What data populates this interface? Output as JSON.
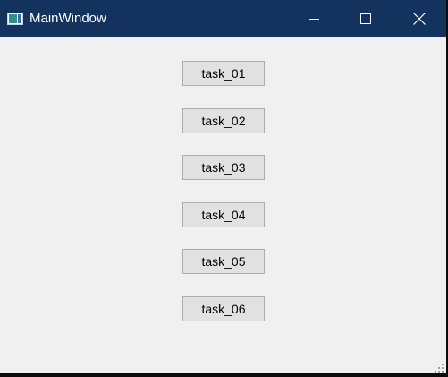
{
  "window": {
    "title": "MainWindow",
    "icon": "app-window-icon",
    "caption_buttons": [
      "minimize-icon",
      "maximize-icon",
      "close-icon"
    ],
    "titlebar_color": "#14325e",
    "client_bg": "#f0f0f0"
  },
  "tasks": [
    {
      "label": "task_01"
    },
    {
      "label": "task_02"
    },
    {
      "label": "task_03"
    },
    {
      "label": "task_04"
    },
    {
      "label": "task_05"
    },
    {
      "label": "task_06"
    }
  ]
}
